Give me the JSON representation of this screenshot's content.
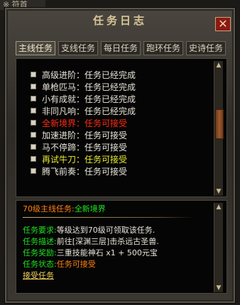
{
  "background_scrap": "※ 符首",
  "title": "任务日志",
  "close_glyph": "✕",
  "tabs": [
    {
      "label": "主线任务",
      "active": true
    },
    {
      "label": "支线任务",
      "active": false
    },
    {
      "label": "每日任务",
      "active": false
    },
    {
      "label": "跑环任务",
      "active": false
    },
    {
      "label": "史诗任务",
      "active": false
    }
  ],
  "quests": [
    {
      "name": "高级进阶",
      "status": "任务已经完成",
      "color": "#e8e4d8"
    },
    {
      "name": "单枪匹马",
      "status": "任务已经完成",
      "color": "#e8e4d8"
    },
    {
      "name": "小有成就",
      "status": "任务已经完成",
      "color": "#e8e4d8"
    },
    {
      "name": "非同凡响",
      "status": "任务已经完成",
      "color": "#e8e4d8"
    },
    {
      "name": "全新境界",
      "status": "任务可接受",
      "color": "#ff2a10"
    },
    {
      "name": "加速进阶",
      "status": "任务可接受",
      "color": "#e8e4d8"
    },
    {
      "name": "马不停蹄",
      "status": "任务可接受",
      "color": "#e8e4d8"
    },
    {
      "name": "再试牛刀",
      "status": "任务可接受",
      "color": "#e8e830"
    },
    {
      "name": "腾飞前奏",
      "status": "任务可接受",
      "color": "#e8e4d8"
    }
  ],
  "separator": "：",
  "scroll": {
    "up": "▲",
    "down": "▼"
  },
  "detail": {
    "heading_prefix": "70级主线任务:",
    "heading_name": "全新境界",
    "requirement_label": "任务要求:",
    "requirement_text": "等级达到70级可领取该任务.",
    "description_label": "任务描述:",
    "description_text": "前往[深渊三层]击杀远古圣兽.",
    "reward_label": "任务奖励:",
    "reward_text": "三重技能神石 x1 + 500元宝",
    "status_label": "任务状态:",
    "status_text": "任务可接受",
    "accept_link": "接受任务"
  }
}
